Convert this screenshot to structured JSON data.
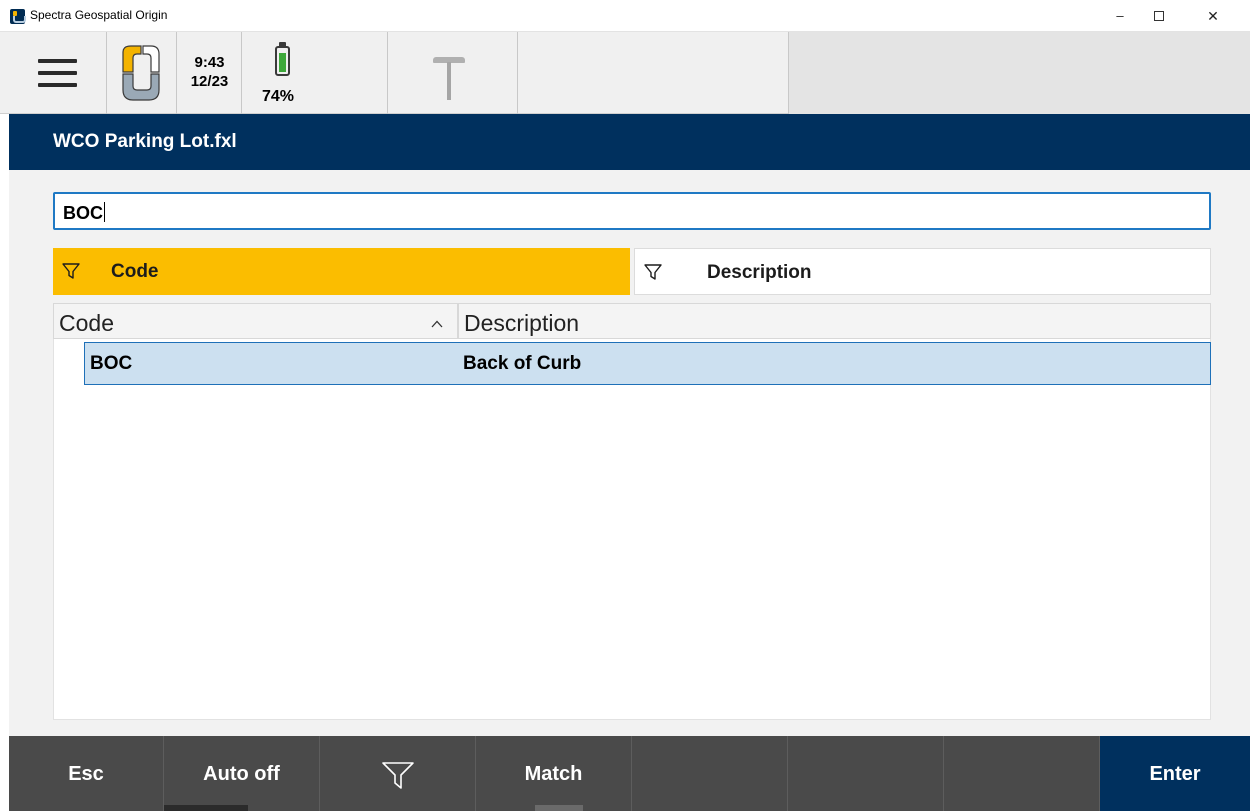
{
  "window": {
    "title": "Spectra Geospatial Origin",
    "controls": {
      "minimize": "–",
      "close": "✕"
    }
  },
  "status_bar": {
    "time": "9:43",
    "date": "12/23",
    "battery_percent": "74%",
    "battery_level": 0.74
  },
  "header": {
    "title": "WCO Parking Lot.fxl"
  },
  "search": {
    "value": "BOC"
  },
  "filter_tabs": [
    {
      "label": "Code",
      "active": true
    },
    {
      "label": "Description",
      "active": false
    }
  ],
  "table": {
    "columns": [
      "Code",
      "Description"
    ],
    "sort_column": "Code",
    "sort_direction": "ascending",
    "rows": [
      {
        "code": "BOC",
        "description": "Back of Curb",
        "selected": true
      }
    ]
  },
  "softkeys": [
    "Esc",
    "Auto off",
    "filter-icon",
    "Match",
    "",
    "",
    "",
    "Enter"
  ],
  "softkey_labels": {
    "esc": "Esc",
    "auto_off": "Auto off",
    "match": "Match",
    "enter": "Enter"
  },
  "colors": {
    "header_navy": "#00305e",
    "active_tab_amber": "#fbbd00",
    "selection_blue": "#cce0f0",
    "focus_border": "#1f79c4",
    "softkey_gray": "#4a4a4a"
  }
}
